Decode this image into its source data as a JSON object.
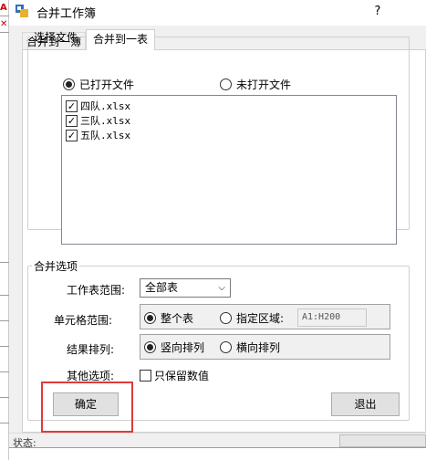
{
  "window": {
    "title": "合并工作簿",
    "help": "?"
  },
  "tabs": [
    {
      "label": "合并到一簿",
      "active": false
    },
    {
      "label": "合并到一表",
      "active": true
    }
  ],
  "file_group": {
    "legend": "选择文件",
    "radio_opened": "已打开文件",
    "radio_unopened": "未打开文件",
    "selected": "opened",
    "files": [
      {
        "name": "四队.xlsx",
        "checked": true
      },
      {
        "name": "三队.xlsx",
        "checked": true
      },
      {
        "name": "五队.xlsx",
        "checked": true
      }
    ]
  },
  "options_group": {
    "legend": "合并选项",
    "sheet_range_label": "工作表范围:",
    "sheet_range_value": "全部表",
    "cell_range_label": "单元格范围:",
    "cell_whole": "整个表",
    "cell_specified": "指定区域:",
    "cell_selected": "whole",
    "range_value": "A1:H200",
    "arrange_label": "结果排列:",
    "arrange_vertical": "竖向排列",
    "arrange_horizontal": "横向排列",
    "arrange_selected": "vertical",
    "other_label": "其他选项:",
    "values_only": "只保留数值",
    "values_only_checked": false
  },
  "buttons": {
    "ok": "确定",
    "exit": "退出"
  },
  "status": {
    "label": "状态:"
  },
  "colors": {
    "highlight": "#e03a3a",
    "panel": "#f0f0f0"
  }
}
